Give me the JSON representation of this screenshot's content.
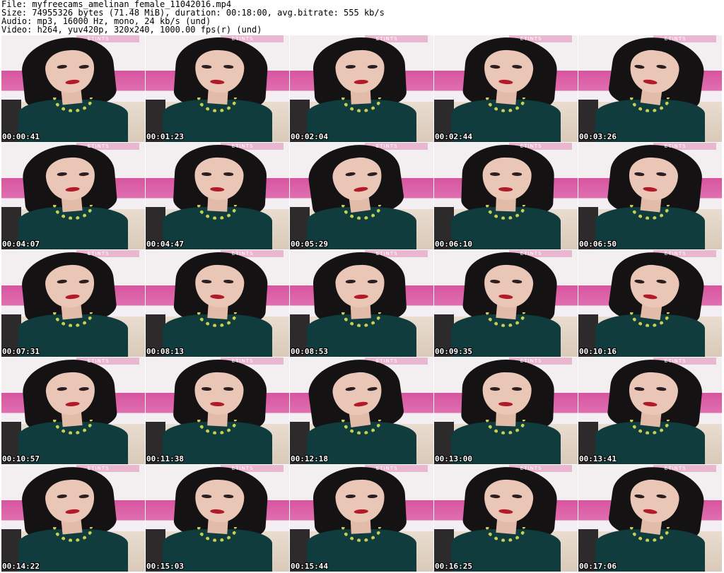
{
  "header": {
    "file_line": "File: myfreecams_amelinan_female_11042016.mp4",
    "size_line": "Size: 74955326 bytes (71.48 MiB), duration: 00:18:00, avg.bitrate: 555 kb/s",
    "audio_line": "Audio: mp3, 16000 Hz, mono, 24 kb/s (und)",
    "video_line": "Video: h264, yuv420p, 320x240, 1000.00 fps(r) (und)"
  },
  "thumbnails": [
    {
      "timestamp": "00:00:41"
    },
    {
      "timestamp": "00:01:23"
    },
    {
      "timestamp": "00:02:04"
    },
    {
      "timestamp": "00:02:44"
    },
    {
      "timestamp": "00:03:26"
    },
    {
      "timestamp": "00:04:07"
    },
    {
      "timestamp": "00:04:47"
    },
    {
      "timestamp": "00:05:29"
    },
    {
      "timestamp": "00:06:10"
    },
    {
      "timestamp": "00:06:50"
    },
    {
      "timestamp": "00:07:31"
    },
    {
      "timestamp": "00:08:13"
    },
    {
      "timestamp": "00:08:53"
    },
    {
      "timestamp": "00:09:35"
    },
    {
      "timestamp": "00:10:16"
    },
    {
      "timestamp": "00:10:57"
    },
    {
      "timestamp": "00:11:38"
    },
    {
      "timestamp": "00:12:18"
    },
    {
      "timestamp": "00:13:00"
    },
    {
      "timestamp": "00:13:41"
    },
    {
      "timestamp": "00:14:22"
    },
    {
      "timestamp": "00:15:03"
    },
    {
      "timestamp": "00:15:44"
    },
    {
      "timestamp": "00:16:25"
    },
    {
      "timestamp": "00:17:06"
    }
  ],
  "banner_text": "ETINTS",
  "colors": {
    "dress": "#103c3e",
    "necklace": "#c7cf52",
    "wall_stripe": "#d7559f",
    "hair": "#151214"
  }
}
